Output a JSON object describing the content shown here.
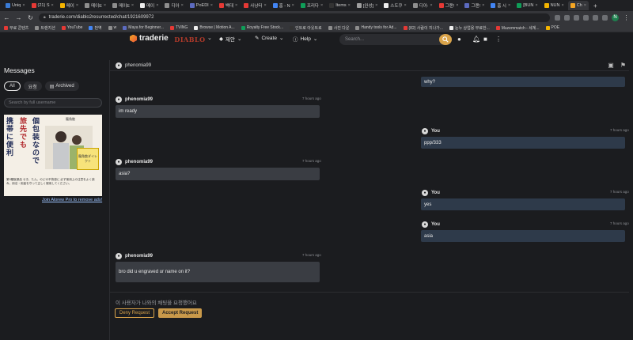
{
  "browser": {
    "tabs": [
      {
        "label": "Uniq",
        "color": "#3a7bd5"
      },
      {
        "label": "(21) S",
        "color": "#e53935"
      },
      {
        "label": "메이",
        "color": "#f4b400"
      },
      {
        "label": "메이E",
        "color": "#8e8e8e"
      },
      {
        "label": "메이E",
        "color": "#8e8e8e"
      },
      {
        "label": "메이",
        "color": "#eeeeee"
      },
      {
        "label": "디아",
        "color": "#8e8e8e"
      },
      {
        "label": "PoEDI",
        "color": "#5c6bc0"
      },
      {
        "label": "백대",
        "color": "#e53935"
      },
      {
        "label": "사냥터",
        "color": "#e53935"
      },
      {
        "label": "홈 - N",
        "color": "#4285f4"
      },
      {
        "label": "프리다",
        "color": "#0f9d58"
      },
      {
        "label": "Items",
        "color": "#333333"
      },
      {
        "label": "[완성]",
        "color": "#9e9e9e"
      },
      {
        "label": "스도쿠",
        "color": "#eeeeee"
      },
      {
        "label": "디아:",
        "color": "#8e8e8e"
      },
      {
        "label": "그랜!",
        "color": "#e53935"
      },
      {
        "label": "그랜!",
        "color": "#5c6bc0"
      },
      {
        "label": "홈 시",
        "color": "#4285f4"
      },
      {
        "label": "[BUN",
        "color": "#0f9d58"
      },
      {
        "label": "NUN",
        "color": "#f4b400"
      },
      {
        "label": "Ch",
        "color": "#f5a623"
      }
    ],
    "active_tab_index": 21,
    "url": "traderie.com/diablo2resurrected/chat/1921609972",
    "bookmarks": [
      {
        "label": "무료 콘텐츠",
        "color": "#e53935"
      },
      {
        "label": "트랜지션",
        "color": "#8e8e8e"
      },
      {
        "label": "YouTube",
        "color": "#e53935"
      },
      {
        "label": "번역",
        "color": "#4285f4"
      },
      {
        "label": "w",
        "color": "#8e8e8e"
      },
      {
        "label": "Maya for Beginner...",
        "color": "#5c6bc0"
      },
      {
        "label": "TVING",
        "color": "#e53935"
      },
      {
        "label": "Browse | Motion A...",
        "color": "#eeeeee"
      },
      {
        "label": "Royalty Free Stock...",
        "color": "#0f9d58"
      },
      {
        "label": "인트로 아웃트로",
        "color": "#333333"
      },
      {
        "label": "사진 다운",
        "color": "#8e8e8e"
      },
      {
        "label": "Handy tools for Ad...",
        "color": "#8e8e8e"
      },
      {
        "label": "(82) 사람이 지나가...",
        "color": "#e53935"
      },
      {
        "label": "눈누 상업용 무료한...",
        "color": "#eeeeee"
      },
      {
        "label": "Muzemmatch - 세계...",
        "color": "#e53935"
      },
      {
        "label": "POE",
        "color": "#f4b400"
      }
    ]
  },
  "site": {
    "logo_text": "traderie",
    "game_logo": "DIABLO",
    "menu": [
      {
        "label": "제안",
        "icon": "tag-icon"
      },
      {
        "label": "Create",
        "icon": "edit-icon"
      },
      {
        "label": "Help",
        "icon": "info-icon"
      }
    ],
    "search_placeholder": "Search...",
    "accent_color": "#d9a34a"
  },
  "sidebar": {
    "title": "Messages",
    "filters": [
      {
        "label": "All",
        "active": true
      },
      {
        "label": "요청",
        "active": false
      },
      {
        "label": "Archived",
        "active": false
      }
    ],
    "search_placeholder": "Search by full username",
    "ad": {
      "headline_1": "携帯に便利",
      "headline_2": "旅先でも",
      "headline_3": "個包装なので",
      "brand": "龍角散",
      "product": "龍角散ダイレクト",
      "fine_print": "第3類医薬品 せき、たん、のどの不快感に 必ず使用上の注意をよく読み、用法・用量を守って正しく服用してください。"
    },
    "remove_ads_link": "Join Alorew Pro to remove ads!"
  },
  "chat": {
    "partner": "phenomia99",
    "messages": [
      {
        "author": "",
        "time": "",
        "text": "why?",
        "mine": true
      },
      {
        "author": "phenomia99",
        "time": "7 hours ago",
        "text": "im ready",
        "mine": false
      },
      {
        "author": "You",
        "time": "7 hours ago",
        "text": "ppp/333",
        "mine": true
      },
      {
        "author": "phenomia99",
        "time": "7 hours ago",
        "text": "asia?",
        "mine": false
      },
      {
        "author": "You",
        "time": "7 hours ago",
        "text": "yes",
        "mine": true
      },
      {
        "author": "You",
        "time": "7 hours ago",
        "text": "asia",
        "mine": true
      },
      {
        "author": "phenomia99",
        "time": "7 hours ago",
        "text": "bro did u engraved ur name on it?",
        "mine": false
      }
    ],
    "request_notice": "이 사용자가 나와의 채팅을 요청했어요",
    "deny_label": "Deny Request",
    "accept_label": "Accept Request"
  }
}
